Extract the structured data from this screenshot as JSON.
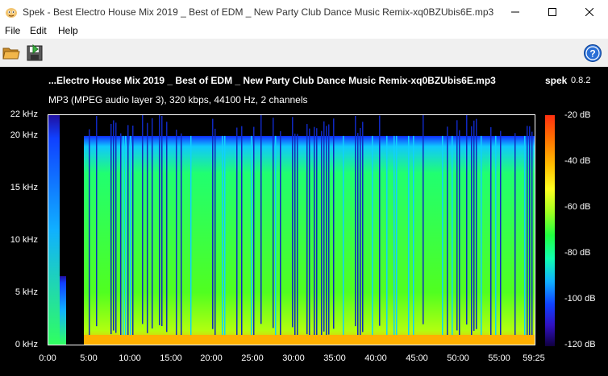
{
  "window": {
    "title": "Spek - Best Electro House Mix 2019 _ Best of EDM _ New Party Club Dance Music Remix-xq0BZUbis6E.mp3",
    "minimize_glyph": "—",
    "maximize_glyph": "☐",
    "close_glyph": "✕"
  },
  "menu": [
    "File",
    "Edit",
    "Help"
  ],
  "toolbar": {
    "open_icon": "folder-open-icon",
    "save_icon": "save-icon",
    "help_icon": "help-icon"
  },
  "spectrum": {
    "file_title": "...Electro House Mix 2019 _ Best of EDM _ New Party Club Dance Music Remix-xq0BZUbis6E.mp3",
    "app_name": "spek",
    "app_version": "0.8.2",
    "info": "MP3 (MPEG audio layer 3), 320 kbps, 44100 Hz, 2 channels",
    "freq_labels": [
      "22 kHz",
      "20 kHz",
      "15 kHz",
      "10 kHz",
      "5 kHz",
      "0 kHz"
    ],
    "freq_values_khz": [
      22,
      20,
      15,
      10,
      5,
      0
    ],
    "time_labels": [
      "0:00",
      "5:00",
      "10:00",
      "15:00",
      "20:00",
      "25:00",
      "30:00",
      "35:00",
      "40:00",
      "45:00",
      "50:00",
      "55:00",
      "59:25"
    ],
    "time_values_sec": [
      0,
      300,
      600,
      900,
      1200,
      1500,
      1800,
      2100,
      2400,
      2700,
      3000,
      3300,
      3565
    ],
    "db_labels": [
      "-20 dB",
      "-40 dB",
      "-60 dB",
      "-80 dB",
      "-100 dB",
      "-120 dB"
    ],
    "db_values": [
      -20,
      -40,
      -60,
      -80,
      -100,
      -120
    ],
    "cutoff_khz": 20,
    "duration_sec": 3565
  },
  "colors": {
    "background": "#000000",
    "signal_high": "#ff3010",
    "signal_mid": "#20ff40",
    "signal_low": "#1040ff"
  }
}
